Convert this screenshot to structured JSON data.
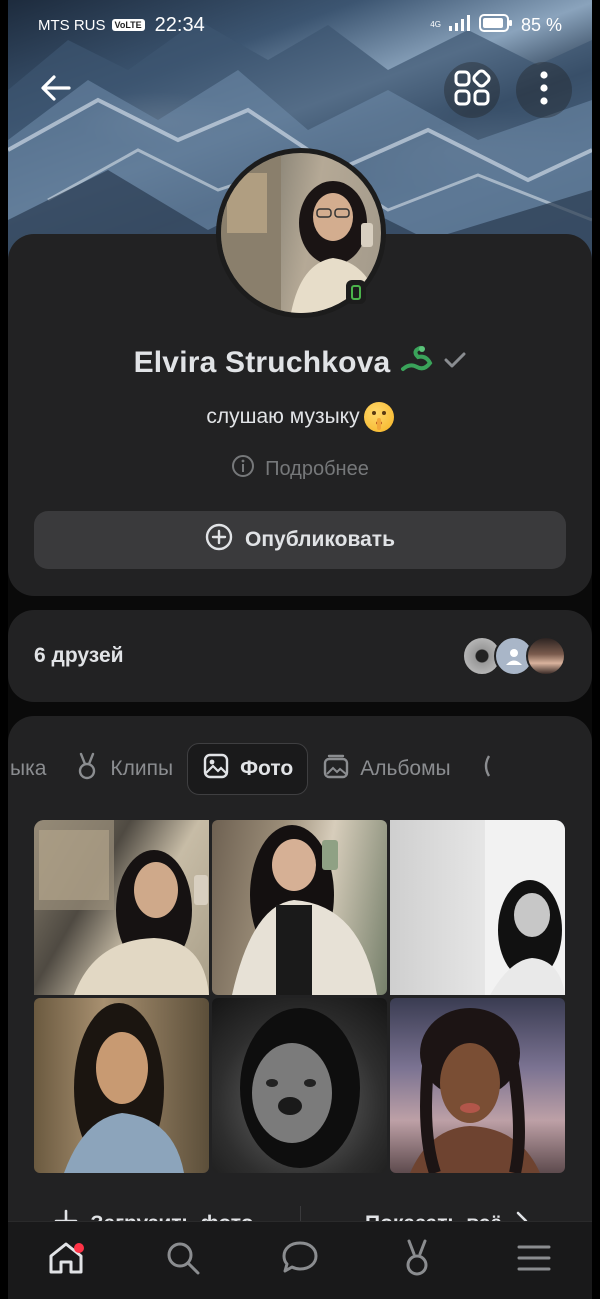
{
  "status_bar": {
    "carrier": "MTS RUS",
    "volte": "VoLTE",
    "time": "22:34",
    "network": "4G",
    "battery": "85 %"
  },
  "header": {
    "back_icon": "arrow-left-icon",
    "apps_icon": "apps-grid-icon",
    "more_icon": "more-vertical-icon"
  },
  "profile": {
    "name": "Elvira Struchkova",
    "status": "слушаю музыку",
    "details_label": "Подробнее",
    "publish_label": "Опубликовать",
    "verified_color": "#8a8d91",
    "online_color": "#4bb34b"
  },
  "friends": {
    "label": "6 друзей",
    "avatar_count": 3
  },
  "media": {
    "tabs": [
      {
        "label": "ыка",
        "icon": "music-icon"
      },
      {
        "label": "Клипы",
        "icon": "clips-icon"
      },
      {
        "label": "Фото",
        "icon": "photo-icon",
        "active": true
      },
      {
        "label": "Альбомы",
        "icon": "albums-icon"
      }
    ],
    "photos_count": 6,
    "upload_label": "Загрузить фото",
    "show_all_label": "Показать всё"
  },
  "bottom_nav": {
    "items": [
      "home-icon",
      "search-icon",
      "messages-icon",
      "clips-icon",
      "menu-icon"
    ],
    "home_badge_color": "#ff3347"
  }
}
